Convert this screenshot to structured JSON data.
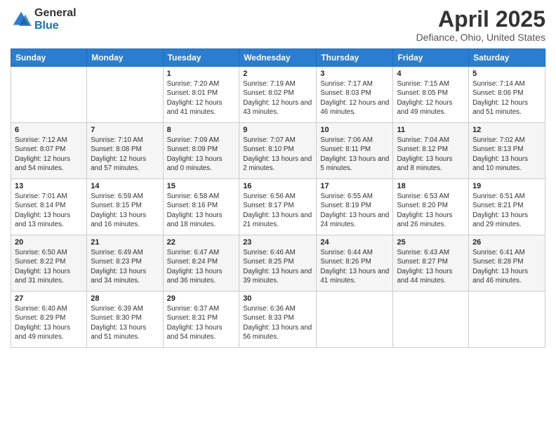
{
  "header": {
    "logo_general": "General",
    "logo_blue": "Blue",
    "month_title": "April 2025",
    "location": "Defiance, Ohio, United States"
  },
  "days_of_week": [
    "Sunday",
    "Monday",
    "Tuesday",
    "Wednesday",
    "Thursday",
    "Friday",
    "Saturday"
  ],
  "weeks": [
    [
      {
        "day": "",
        "sunrise": "",
        "sunset": "",
        "daylight": ""
      },
      {
        "day": "",
        "sunrise": "",
        "sunset": "",
        "daylight": ""
      },
      {
        "day": "1",
        "sunrise": "Sunrise: 7:20 AM",
        "sunset": "Sunset: 8:01 PM",
        "daylight": "Daylight: 12 hours and 41 minutes."
      },
      {
        "day": "2",
        "sunrise": "Sunrise: 7:19 AM",
        "sunset": "Sunset: 8:02 PM",
        "daylight": "Daylight: 12 hours and 43 minutes."
      },
      {
        "day": "3",
        "sunrise": "Sunrise: 7:17 AM",
        "sunset": "Sunset: 8:03 PM",
        "daylight": "Daylight: 12 hours and 46 minutes."
      },
      {
        "day": "4",
        "sunrise": "Sunrise: 7:15 AM",
        "sunset": "Sunset: 8:05 PM",
        "daylight": "Daylight: 12 hours and 49 minutes."
      },
      {
        "day": "5",
        "sunrise": "Sunrise: 7:14 AM",
        "sunset": "Sunset: 8:06 PM",
        "daylight": "Daylight: 12 hours and 51 minutes."
      }
    ],
    [
      {
        "day": "6",
        "sunrise": "Sunrise: 7:12 AM",
        "sunset": "Sunset: 8:07 PM",
        "daylight": "Daylight: 12 hours and 54 minutes."
      },
      {
        "day": "7",
        "sunrise": "Sunrise: 7:10 AM",
        "sunset": "Sunset: 8:08 PM",
        "daylight": "Daylight: 12 hours and 57 minutes."
      },
      {
        "day": "8",
        "sunrise": "Sunrise: 7:09 AM",
        "sunset": "Sunset: 8:09 PM",
        "daylight": "Daylight: 13 hours and 0 minutes."
      },
      {
        "day": "9",
        "sunrise": "Sunrise: 7:07 AM",
        "sunset": "Sunset: 8:10 PM",
        "daylight": "Daylight: 13 hours and 2 minutes."
      },
      {
        "day": "10",
        "sunrise": "Sunrise: 7:06 AM",
        "sunset": "Sunset: 8:11 PM",
        "daylight": "Daylight: 13 hours and 5 minutes."
      },
      {
        "day": "11",
        "sunrise": "Sunrise: 7:04 AM",
        "sunset": "Sunset: 8:12 PM",
        "daylight": "Daylight: 13 hours and 8 minutes."
      },
      {
        "day": "12",
        "sunrise": "Sunrise: 7:02 AM",
        "sunset": "Sunset: 8:13 PM",
        "daylight": "Daylight: 13 hours and 10 minutes."
      }
    ],
    [
      {
        "day": "13",
        "sunrise": "Sunrise: 7:01 AM",
        "sunset": "Sunset: 8:14 PM",
        "daylight": "Daylight: 13 hours and 13 minutes."
      },
      {
        "day": "14",
        "sunrise": "Sunrise: 6:59 AM",
        "sunset": "Sunset: 8:15 PM",
        "daylight": "Daylight: 13 hours and 16 minutes."
      },
      {
        "day": "15",
        "sunrise": "Sunrise: 6:58 AM",
        "sunset": "Sunset: 8:16 PM",
        "daylight": "Daylight: 13 hours and 18 minutes."
      },
      {
        "day": "16",
        "sunrise": "Sunrise: 6:56 AM",
        "sunset": "Sunset: 8:17 PM",
        "daylight": "Daylight: 13 hours and 21 minutes."
      },
      {
        "day": "17",
        "sunrise": "Sunrise: 6:55 AM",
        "sunset": "Sunset: 8:19 PM",
        "daylight": "Daylight: 13 hours and 24 minutes."
      },
      {
        "day": "18",
        "sunrise": "Sunrise: 6:53 AM",
        "sunset": "Sunset: 8:20 PM",
        "daylight": "Daylight: 13 hours and 26 minutes."
      },
      {
        "day": "19",
        "sunrise": "Sunrise: 6:51 AM",
        "sunset": "Sunset: 8:21 PM",
        "daylight": "Daylight: 13 hours and 29 minutes."
      }
    ],
    [
      {
        "day": "20",
        "sunrise": "Sunrise: 6:50 AM",
        "sunset": "Sunset: 8:22 PM",
        "daylight": "Daylight: 13 hours and 31 minutes."
      },
      {
        "day": "21",
        "sunrise": "Sunrise: 6:49 AM",
        "sunset": "Sunset: 8:23 PM",
        "daylight": "Daylight: 13 hours and 34 minutes."
      },
      {
        "day": "22",
        "sunrise": "Sunrise: 6:47 AM",
        "sunset": "Sunset: 8:24 PM",
        "daylight": "Daylight: 13 hours and 36 minutes."
      },
      {
        "day": "23",
        "sunrise": "Sunrise: 6:46 AM",
        "sunset": "Sunset: 8:25 PM",
        "daylight": "Daylight: 13 hours and 39 minutes."
      },
      {
        "day": "24",
        "sunrise": "Sunrise: 6:44 AM",
        "sunset": "Sunset: 8:26 PM",
        "daylight": "Daylight: 13 hours and 41 minutes."
      },
      {
        "day": "25",
        "sunrise": "Sunrise: 6:43 AM",
        "sunset": "Sunset: 8:27 PM",
        "daylight": "Daylight: 13 hours and 44 minutes."
      },
      {
        "day": "26",
        "sunrise": "Sunrise: 6:41 AM",
        "sunset": "Sunset: 8:28 PM",
        "daylight": "Daylight: 13 hours and 46 minutes."
      }
    ],
    [
      {
        "day": "27",
        "sunrise": "Sunrise: 6:40 AM",
        "sunset": "Sunset: 8:29 PM",
        "daylight": "Daylight: 13 hours and 49 minutes."
      },
      {
        "day": "28",
        "sunrise": "Sunrise: 6:39 AM",
        "sunset": "Sunset: 8:30 PM",
        "daylight": "Daylight: 13 hours and 51 minutes."
      },
      {
        "day": "29",
        "sunrise": "Sunrise: 6:37 AM",
        "sunset": "Sunset: 8:31 PM",
        "daylight": "Daylight: 13 hours and 54 minutes."
      },
      {
        "day": "30",
        "sunrise": "Sunrise: 6:36 AM",
        "sunset": "Sunset: 8:33 PM",
        "daylight": "Daylight: 13 hours and 56 minutes."
      },
      {
        "day": "",
        "sunrise": "",
        "sunset": "",
        "daylight": ""
      },
      {
        "day": "",
        "sunrise": "",
        "sunset": "",
        "daylight": ""
      },
      {
        "day": "",
        "sunrise": "",
        "sunset": "",
        "daylight": ""
      }
    ]
  ]
}
